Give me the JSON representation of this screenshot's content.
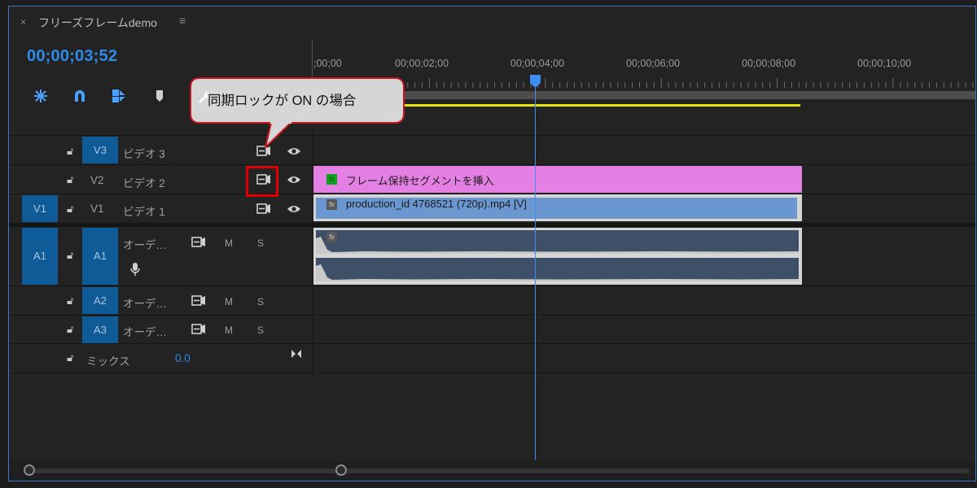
{
  "panel": {
    "close_glyph": "×",
    "title": "フリーズフレームdemo",
    "menu_glyph": "≡",
    "timecode": "00;00;03;52"
  },
  "toolbar": {
    "icons": [
      "snap-icon",
      "magnet-icon",
      "linked-selection-icon",
      "marker-icon",
      "settings-wrench-icon"
    ]
  },
  "ruler": {
    "labels": [
      ";00;00",
      "00;00;02;00",
      "00;00;04;00",
      "00;00;06;00",
      "00;00;08;00",
      "00;00;10;00"
    ]
  },
  "callout": {
    "text": "同期ロックが ON の場合"
  },
  "tracks": {
    "v3": {
      "target": "V3",
      "name": "ビデオ 3"
    },
    "v2": {
      "target": "V2",
      "name": "ビデオ 2"
    },
    "v1": {
      "source": "V1",
      "target": "V1",
      "name": "ビデオ 1"
    },
    "a1": {
      "source": "A1",
      "target": "A1",
      "name": "オーデ…",
      "mute": "M",
      "solo": "S"
    },
    "a2": {
      "target": "A2",
      "name": "オーデ…",
      "mute": "M",
      "solo": "S"
    },
    "a3": {
      "target": "A3",
      "name": "オーデ…",
      "mute": "M",
      "solo": "S"
    },
    "mix": {
      "name": "ミックス",
      "value": "0.0"
    }
  },
  "clips": {
    "adjustment": {
      "title": "フレーム保持セグメントを挿入",
      "fx": "fx"
    },
    "video": {
      "title": "production_id 4768521 (720p).mp4 [V]",
      "fx": "fx"
    },
    "audio": {
      "fx": "fx"
    }
  },
  "colors": {
    "accent_blue": "#2d8ceb",
    "target_blue": "#0f5b97",
    "adjustment_clip": "#e47fe3",
    "video_clip": "#6a97cf",
    "audio_clip": "#3e5068",
    "highlight_red": "#e00000",
    "work_area_yellow": "#e3e30f"
  }
}
